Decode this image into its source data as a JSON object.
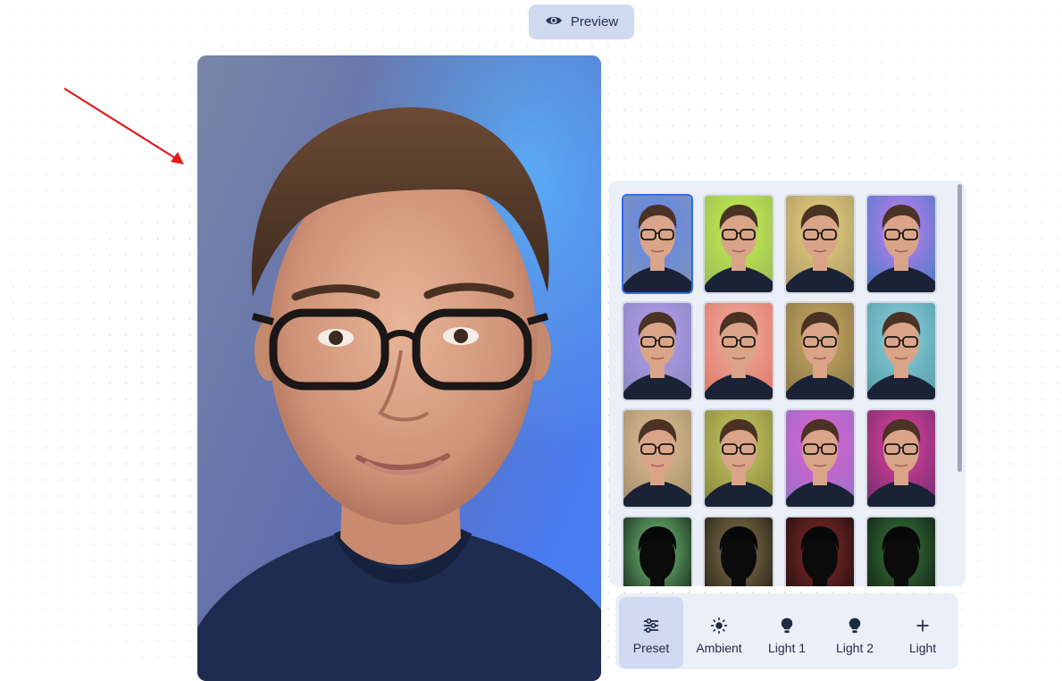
{
  "header": {
    "preview_label": "Preview",
    "preview_icon": "eye-icon"
  },
  "annotation": {
    "arrow_color": "#e01b1b"
  },
  "preset_panel": {
    "selected_index": 0,
    "thumbnails": [
      {
        "bg": "#7f93b8",
        "glow": "#5f86f0",
        "light": true
      },
      {
        "bg": "#9bbf5a",
        "glow": "#c6ef4a",
        "light": true
      },
      {
        "bg": "#b09a6a",
        "glow": "#e6d47a",
        "light": true
      },
      {
        "bg": "#4f7dc8",
        "glow": "#c77cf0",
        "light": true
      },
      {
        "bg": "#8b88c0",
        "glow": "#b59cf0",
        "light": true
      },
      {
        "bg": "#e07a6a",
        "glow": "#f0b0a0",
        "light": true
      },
      {
        "bg": "#8c7a4a",
        "glow": "#c9a860",
        "light": true
      },
      {
        "bg": "#5aa0a8",
        "glow": "#8ad0e0",
        "light": true
      },
      {
        "bg": "#a69070",
        "glow": "#e0c090",
        "light": true
      },
      {
        "bg": "#8a8a40",
        "glow": "#c8c860",
        "light": true
      },
      {
        "bg": "#9a70c8",
        "glow": "#e060d0",
        "light": true
      },
      {
        "bg": "#7a3070",
        "glow": "#e040a0",
        "light": true
      },
      {
        "bg": "#0e1a12",
        "glow": "#7ad080",
        "light": false
      },
      {
        "bg": "#1e1a12",
        "glow": "#8a7a50",
        "light": false
      },
      {
        "bg": "#1a0e0e",
        "glow": "#8a2a2a",
        "light": false
      },
      {
        "bg": "#0e1a10",
        "glow": "#3a7a40",
        "light": false
      }
    ]
  },
  "toolbar": {
    "tools": [
      {
        "label": "Preset",
        "icon": "sliders-icon",
        "active": true
      },
      {
        "label": "Ambient",
        "icon": "sun-icon",
        "active": false
      },
      {
        "label": "Light 1",
        "icon": "lightbulb-icon",
        "active": false
      },
      {
        "label": "Light 2",
        "icon": "lightbulb-icon",
        "active": false
      },
      {
        "label": "Light",
        "icon": "plus-icon",
        "active": false
      }
    ]
  }
}
